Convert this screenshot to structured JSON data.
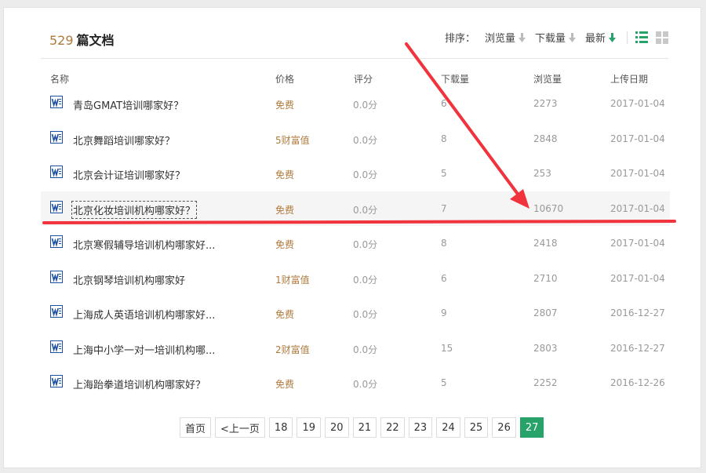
{
  "header": {
    "count": "529",
    "unit": "篇文档",
    "sort_label": "排序：",
    "sort_options": [
      "浏览量",
      "下载量",
      "最新"
    ]
  },
  "columns": [
    "名称",
    "价格",
    "评分",
    "下载量",
    "浏览量",
    "上传日期"
  ],
  "rows": [
    {
      "name": "青岛GMAT培训哪家好？",
      "price": "免费",
      "score": "0.0分",
      "downloads": "6",
      "views": "2273",
      "date": "2017-01-04"
    },
    {
      "name": "北京舞蹈培训哪家好？",
      "price": "5财富值",
      "score": "0.0分",
      "downloads": "8",
      "views": "2848",
      "date": "2017-01-04"
    },
    {
      "name": "北京会计证培训哪家好？",
      "price": "免费",
      "score": "0.0分",
      "downloads": "5",
      "views": "253",
      "date": "2017-01-04"
    },
    {
      "name": "北京化妆培训机构哪家好？",
      "price": "免费",
      "score": "0.0分",
      "downloads": "7",
      "views": "10670",
      "date": "2017-01-04"
    },
    {
      "name": "北京寒假辅导培训机构哪家好...",
      "price": "免费",
      "score": "0.0分",
      "downloads": "8",
      "views": "2418",
      "date": "2017-01-04"
    },
    {
      "name": "北京钢琴培训机构哪家好",
      "price": "1财富值",
      "score": "0.0分",
      "downloads": "6",
      "views": "2710",
      "date": "2017-01-04"
    },
    {
      "name": "上海成人英语培训机构哪家好...",
      "price": "免费",
      "score": "0.0分",
      "downloads": "9",
      "views": "2807",
      "date": "2016-12-27"
    },
    {
      "name": "上海中小学一对一培训机构哪...",
      "price": "2财富值",
      "score": "0.0分",
      "downloads": "15",
      "views": "2803",
      "date": "2016-12-27"
    },
    {
      "name": "上海跆拳道培训机构哪家好？",
      "price": "免费",
      "score": "0.0分",
      "downloads": "5",
      "views": "2252",
      "date": "2016-12-26"
    }
  ],
  "pagination": {
    "first": "首页",
    "prev": "<上一页",
    "pages": [
      "18",
      "19",
      "20",
      "21",
      "22",
      "23",
      "24",
      "25",
      "26",
      "27"
    ],
    "current": "27"
  },
  "colors": {
    "accent_green": "#27a36a",
    "price_brown": "#b07a3c",
    "annotation_red": "#f0333c",
    "word_blue": "#1d4fa3"
  },
  "icons": {
    "doc": "word-doc-icon",
    "sort_arrow": "arrow-down-icon",
    "list_view": "list-view-icon",
    "grid_view": "grid-view-icon"
  }
}
